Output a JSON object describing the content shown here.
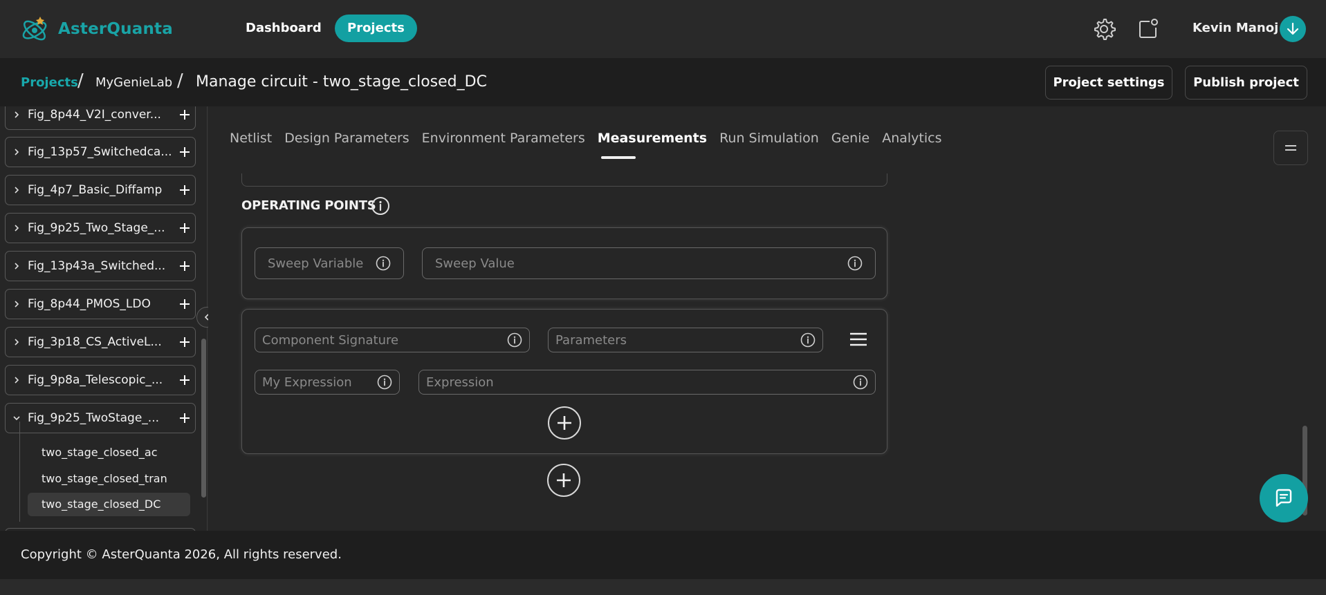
{
  "brand": {
    "name": "AsterQuanta",
    "accent": "#13a0a2"
  },
  "nav": {
    "dashboard": "Dashboard",
    "projects": "Projects"
  },
  "user": {
    "name": "Kevin Manoj"
  },
  "breadcrumb": {
    "root": "Projects",
    "sep": "/",
    "project": "MyGenieLab",
    "current": "Manage circuit - two_stage_closed_DC"
  },
  "header_buttons": {
    "settings": "Project settings",
    "publish": "Publish project"
  },
  "sidebar": {
    "items": [
      {
        "label": "Fig_8p44_V2I_conver...",
        "expanded": false
      },
      {
        "label": "Fig_13p57_Switchedca...",
        "expanded": false
      },
      {
        "label": "Fig_4p7_Basic_Diffamp",
        "expanded": false
      },
      {
        "label": "Fig_9p25_Two_Stage_...",
        "expanded": false
      },
      {
        "label": "Fig_13p43a_Switched...",
        "expanded": false
      },
      {
        "label": "Fig_8p44_PMOS_LDO",
        "expanded": false
      },
      {
        "label": "Fig_3p18_CS_ActiveL...",
        "expanded": false
      },
      {
        "label": "Fig_9p8a_Telescopic_...",
        "expanded": false
      },
      {
        "label": "Fig_9p25_TwoStage_...",
        "expanded": true
      }
    ],
    "subitems": [
      {
        "label": "two_stage_closed_ac"
      },
      {
        "label": "two_stage_closed_tran"
      },
      {
        "label": "two_stage_closed_DC"
      }
    ]
  },
  "tabs": [
    "Netlist",
    "Design Parameters",
    "Environment Parameters",
    "Measurements",
    "Run Simulation",
    "Genie",
    "Analytics"
  ],
  "active_tab": "Measurements",
  "section": {
    "title": "OPERATING POINTS"
  },
  "fields": {
    "sweep_variable": "Sweep Variable",
    "sweep_value": "Sweep Value",
    "component_signature": "Component Signature",
    "parameters": "Parameters",
    "my_expression": "My Expression",
    "expression": "Expression"
  },
  "footer": {
    "text": "Copyright © AsterQuanta 2026, All rights reserved."
  }
}
